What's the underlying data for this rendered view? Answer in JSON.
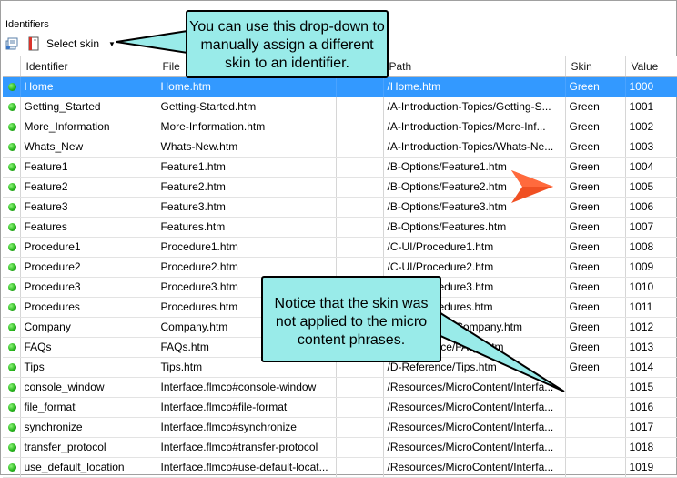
{
  "panel": {
    "title": "Identifiers"
  },
  "toolbar": {
    "select_skin_label": "Select skin",
    "dropdown_arrow": "▼"
  },
  "columns": [
    "Identifier",
    "File",
    "",
    "Path",
    "Skin",
    "Value"
  ],
  "rows": [
    {
      "identifier": "Home",
      "file": "Home.htm",
      "path": "/Home.htm",
      "skin": "Green",
      "value": "1000",
      "selected": true
    },
    {
      "identifier": "Getting_Started",
      "file": "Getting-Started.htm",
      "path": "/A-Introduction-Topics/Getting-S...",
      "skin": "Green",
      "value": "1001"
    },
    {
      "identifier": "More_Information",
      "file": "More-Information.htm",
      "path": "/A-Introduction-Topics/More-Inf...",
      "skin": "Green",
      "value": "1002"
    },
    {
      "identifier": "Whats_New",
      "file": "Whats-New.htm",
      "path": "/A-Introduction-Topics/Whats-Ne...",
      "skin": "Green",
      "value": "1003"
    },
    {
      "identifier": "Feature1",
      "file": "Feature1.htm",
      "path": "/B-Options/Feature1.htm",
      "skin": "Green",
      "value": "1004"
    },
    {
      "identifier": "Feature2",
      "file": "Feature2.htm",
      "path": "/B-Options/Feature2.htm",
      "skin": "Green",
      "value": "1005"
    },
    {
      "identifier": "Feature3",
      "file": "Feature3.htm",
      "path": "/B-Options/Feature3.htm",
      "skin": "Green",
      "value": "1006"
    },
    {
      "identifier": "Features",
      "file": "Features.htm",
      "path": "/B-Options/Features.htm",
      "skin": "Green",
      "value": "1007"
    },
    {
      "identifier": "Procedure1",
      "file": "Procedure1.htm",
      "path": "/C-UI/Procedure1.htm",
      "skin": "Green",
      "value": "1008"
    },
    {
      "identifier": "Procedure2",
      "file": "Procedure2.htm",
      "path": "/C-UI/Procedure2.htm",
      "skin": "Green",
      "value": "1009"
    },
    {
      "identifier": "Procedure3",
      "file": "Procedure3.htm",
      "path": "/C-UI/Procedure3.htm",
      "skin": "Green",
      "value": "1010"
    },
    {
      "identifier": "Procedures",
      "file": "Procedures.htm",
      "path": "/C-UI/Procedures.htm",
      "skin": "Green",
      "value": "1011"
    },
    {
      "identifier": "Company",
      "file": "Company.htm",
      "path": "/D-Reference/Company.htm",
      "skin": "Green",
      "value": "1012"
    },
    {
      "identifier": "FAQs",
      "file": "FAQs.htm",
      "path": "/D-Reference/FAQs.htm",
      "skin": "Green",
      "value": "1013"
    },
    {
      "identifier": "Tips",
      "file": "Tips.htm",
      "path": "/D-Reference/Tips.htm",
      "skin": "Green",
      "value": "1014"
    },
    {
      "identifier": "console_window",
      "file": "Interface.flmco#console-window",
      "path": "/Resources/MicroContent/Interfa...",
      "skin": "",
      "value": "1015"
    },
    {
      "identifier": "file_format",
      "file": "Interface.flmco#file-format",
      "path": "/Resources/MicroContent/Interfa...",
      "skin": "",
      "value": "1016"
    },
    {
      "identifier": "synchronize",
      "file": "Interface.flmco#synchronize",
      "path": "/Resources/MicroContent/Interfa...",
      "skin": "",
      "value": "1017"
    },
    {
      "identifier": "transfer_protocol",
      "file": "Interface.flmco#transfer-protocol",
      "path": "/Resources/MicroContent/Interfa...",
      "skin": "",
      "value": "1018"
    },
    {
      "identifier": "use_default_location",
      "file": "Interface.flmco#use-default-locat...",
      "path": "/Resources/MicroContent/Interfa...",
      "skin": "",
      "value": "1019"
    }
  ],
  "callouts": {
    "dropdown_note": "You can use this drop-down to manually assign a different skin to an identifier.",
    "skin_note": "Notice that the skin was not applied to the micro content phrases."
  },
  "colors": {
    "selection": "#3399ff",
    "callout_fill": "#99ebe9",
    "status_dot": "#27b51c",
    "pointer_arrow": "#f05023"
  },
  "icons": [
    "auto-assign-icon",
    "skin-book-icon",
    "green-status-dot-icon",
    "red-pointer-arrow-icon"
  ]
}
